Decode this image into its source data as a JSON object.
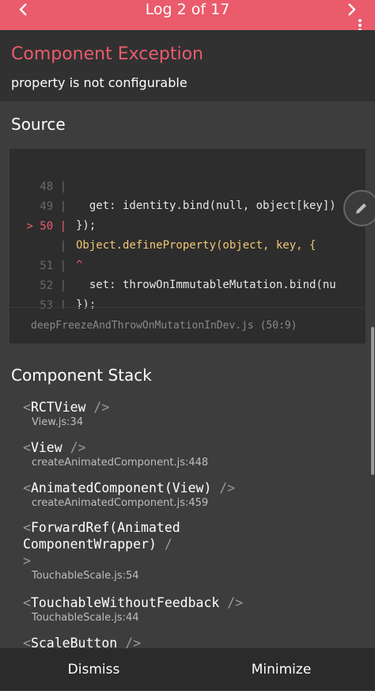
{
  "header": {
    "title": "Log 2 of 17",
    "prev_icon": "chevron-left-icon",
    "next_icon": "chevron-right-icon",
    "menu_icon": "kebab-menu-icon"
  },
  "exception": {
    "title": "Component Exception",
    "message": "property is not configurable"
  },
  "source": {
    "title": "Source",
    "lines": [
      {
        "gutter": "48 |",
        "code": "  get: identity.bind(null, object[key])"
      },
      {
        "gutter": "49 |",
        "code": "});"
      },
      {
        "gutter": "> 50 |",
        "code": "Object.defineProperty(object, key, {"
      },
      {
        "gutter": "|",
        "code": "^"
      },
      {
        "gutter": "51 |",
        "code": "  set: throwOnImmutableMutation.bind(nu"
      },
      {
        "gutter": "52 |",
        "code": "});"
      },
      {
        "gutter": "53 |",
        "code": "}"
      }
    ],
    "file": "deepFreezeAndThrowOnMutationInDev.js (50:9)",
    "edit_icon": "pencil-icon"
  },
  "component_stack": {
    "title": "Component Stack",
    "frames": [
      {
        "name": "RCTView",
        "location": "View.js:34"
      },
      {
        "name": "View",
        "location": "createAnimatedComponent.js:448"
      },
      {
        "name": "AnimatedComponent(View)",
        "location": "createAnimatedComponent.js:459"
      },
      {
        "name": "ForwardRef(Animated\nComponentWrapper)",
        "location": "TouchableScale.js:54"
      },
      {
        "name": "TouchableWithoutFeedback",
        "location": "TouchableScale.js:44"
      },
      {
        "name": "ScaleButton",
        "location": ""
      }
    ]
  },
  "footer": {
    "dismiss_label": "Dismiss",
    "minimize_label": "Minimize"
  },
  "colors": {
    "accent": "#ea5b6c",
    "background": "#3d3d3d",
    "keyword": "#6fbf82"
  }
}
